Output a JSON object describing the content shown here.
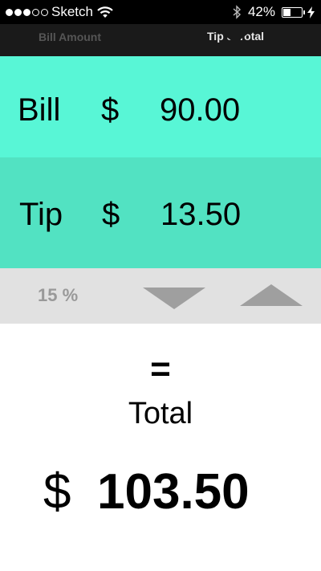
{
  "status_bar": {
    "carrier": "Sketch",
    "battery_percent": "42%",
    "battery_level": 0.42,
    "signal_bars_filled": 3,
    "signal_bars_total": 5
  },
  "tabs": [
    {
      "label": "Bill Amount",
      "active": false
    },
    {
      "label": "Tip & Total",
      "active": true
    }
  ],
  "bill": {
    "label": "Bill",
    "currency": "$",
    "amount": "90.00"
  },
  "tip": {
    "label": "Tip",
    "currency": "$",
    "amount": "13.50"
  },
  "tip_percent": {
    "label": "15 %"
  },
  "total": {
    "equals": "=",
    "label": "Total",
    "currency": "$",
    "amount": "103.50"
  },
  "colors": {
    "bill_row": "#58f6d6",
    "tip_row": "#52e2c2",
    "percent_bar": "#e1e1e1",
    "arrow": "#9f9f9f"
  }
}
